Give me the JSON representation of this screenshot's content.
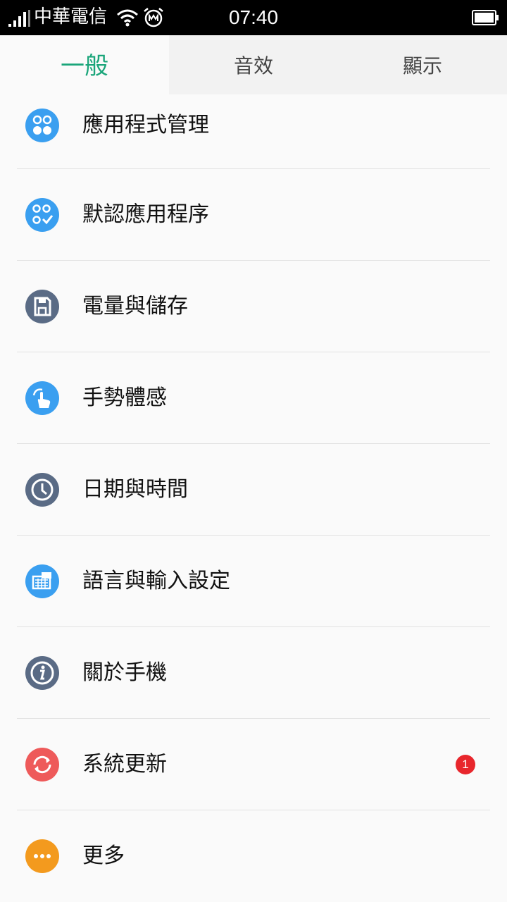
{
  "status_bar": {
    "carrier": "中華電信",
    "time": "07:40"
  },
  "tabs": [
    {
      "label": "一般",
      "active": true
    },
    {
      "label": "音效",
      "active": false
    },
    {
      "label": "顯示",
      "active": false
    }
  ],
  "items": [
    {
      "label": "應用程式管理",
      "icon": "apps-manage-icon",
      "color": "#3a9ff0"
    },
    {
      "label": "默認應用程序",
      "icon": "default-apps-icon",
      "color": "#3a9ff0"
    },
    {
      "label": "電量與儲存",
      "icon": "save-icon",
      "color": "#5a6b85"
    },
    {
      "label": "手勢體感",
      "icon": "gesture-icon",
      "color": "#3a9ff0"
    },
    {
      "label": "日期與時間",
      "icon": "clock-icon",
      "color": "#5a6b85"
    },
    {
      "label": "語言與輸入設定",
      "icon": "keyboard-icon",
      "color": "#3a9ff0"
    },
    {
      "label": "關於手機",
      "icon": "info-icon",
      "color": "#5a6b85"
    },
    {
      "label": "系統更新",
      "icon": "update-icon",
      "color": "#ee5a5a",
      "badge": "1"
    },
    {
      "label": "更多",
      "icon": "more-icon",
      "color": "#f39a1e"
    }
  ],
  "colors": {
    "accent": "#1aa57a",
    "badge": "#e8262c"
  }
}
